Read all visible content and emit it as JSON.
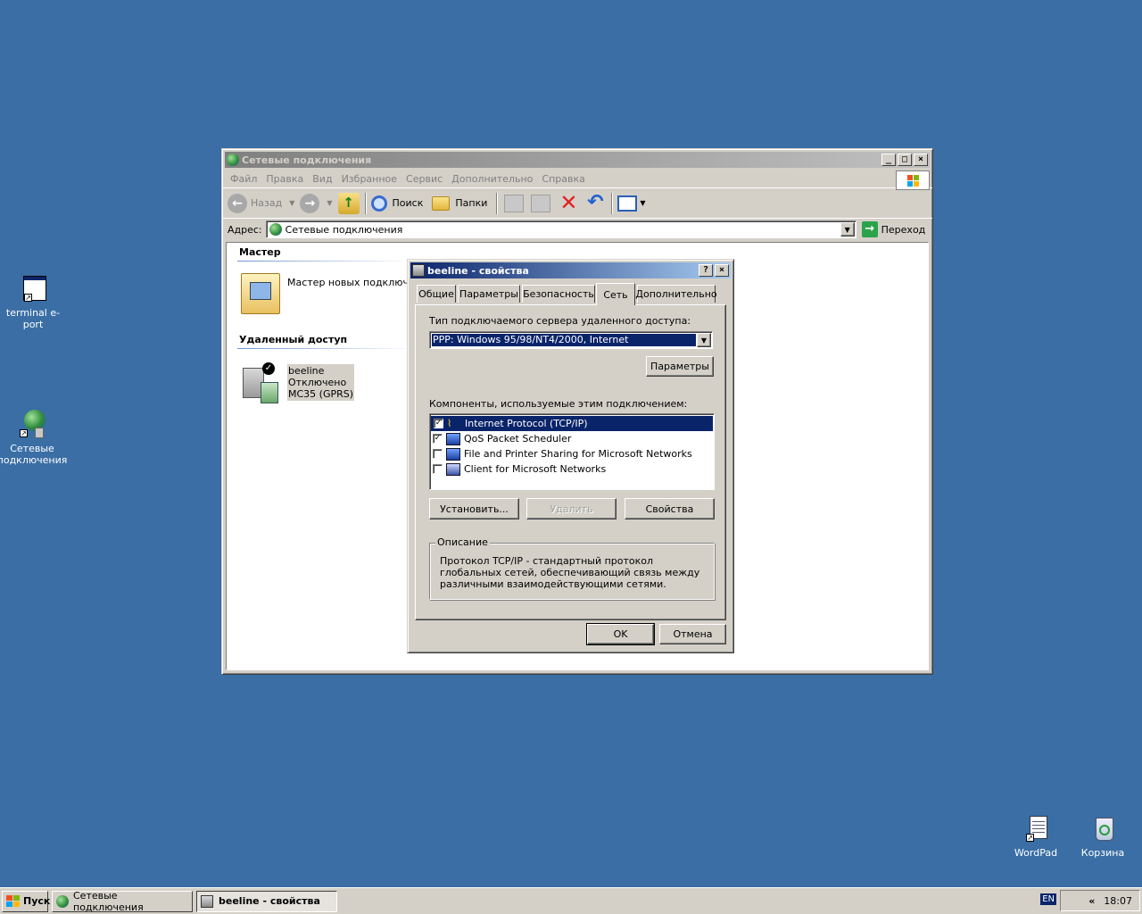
{
  "desktop": {
    "icons": [
      {
        "label": "terminal e-port"
      },
      {
        "label": "Сетевые подключения"
      },
      {
        "label": "WordPad"
      },
      {
        "label": "Корзина"
      }
    ]
  },
  "explorer": {
    "title": "Сетевые подключения",
    "menu": [
      "Файл",
      "Правка",
      "Вид",
      "Избранное",
      "Сервис",
      "Дополнительно",
      "Справка"
    ],
    "toolbar": {
      "back": "Назад",
      "search": "Поиск",
      "folders": "Папки"
    },
    "address": {
      "label": "Адрес:",
      "value": "Сетевые подключения",
      "go": "Переход"
    },
    "sections": {
      "wizard_header": "Мастер",
      "wizard_item": "Мастер новых подключений",
      "remote_header": "Удаленный доступ",
      "connection": {
        "name": "beeline",
        "status": "Отключено",
        "device": "MC35 (GPRS)"
      }
    }
  },
  "dialog": {
    "title": "beeline - свойства",
    "tabs": [
      "Общие",
      "Параметры",
      "Безопасность",
      "Сеть",
      "Дополнительно"
    ],
    "active_tab": "Сеть",
    "server_type_label": "Тип подключаемого сервера удаленного доступа:",
    "server_type_value": "PPP: Windows 95/98/NT4/2000, Internet",
    "params_button": "Параметры",
    "components_label": "Компоненты, используемые этим подключением:",
    "components": [
      {
        "label": "Internet Protocol (TCP/IP)",
        "checked": true,
        "selected": true
      },
      {
        "label": "QoS Packet Scheduler",
        "checked": true,
        "selected": false
      },
      {
        "label": "File and Printer Sharing for Microsoft Networks",
        "checked": false,
        "selected": false
      },
      {
        "label": "Client for Microsoft Networks",
        "checked": false,
        "selected": false
      }
    ],
    "install_button": "Установить...",
    "remove_button": "Удалить",
    "props_button": "Свойства",
    "description_title": "Описание",
    "description_text": "Протокол TCP/IP - стандартный протокол глобальных сетей, обеспечивающий связь между различными взаимодействующими сетями.",
    "ok_button": "OK",
    "cancel_button": "Отмена"
  },
  "taskbar": {
    "start": "Пуск",
    "tasks": [
      {
        "label": "Сетевые подключения"
      },
      {
        "label": "beeline - свойства"
      }
    ],
    "lang": "EN",
    "chevron": "«",
    "clock": "18:07"
  }
}
